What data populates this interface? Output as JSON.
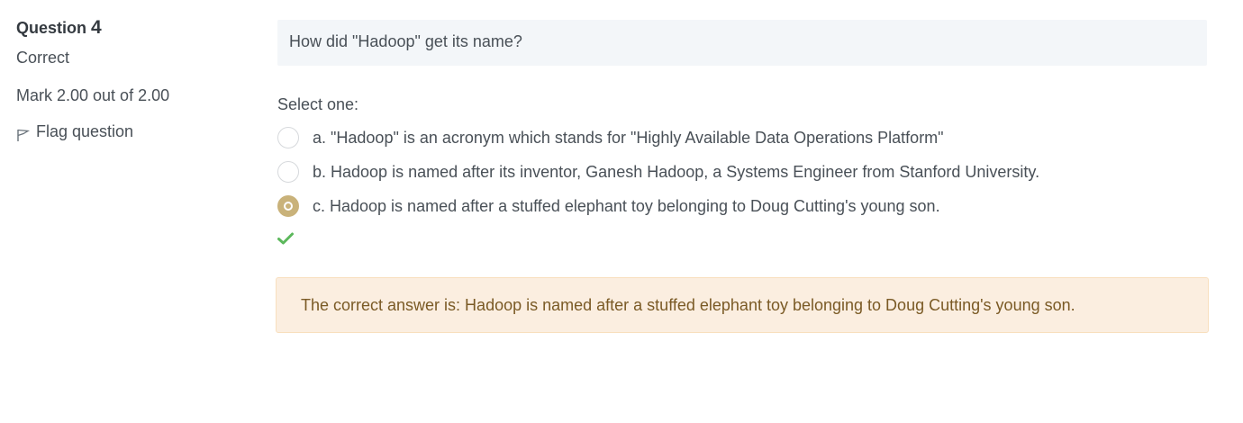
{
  "question": {
    "label": "Question",
    "number": "4",
    "state": "Correct",
    "grade": "Mark 2.00 out of 2.00",
    "flag_label": "Flag question",
    "text": "How did \"Hadoop\" get its name?"
  },
  "prompt": "Select one:",
  "answers": [
    {
      "label": "a. \"Hadoop\" is an acronym which stands for \"Highly Available Data Operations Platform\"",
      "selected": false
    },
    {
      "label": "b. Hadoop is named after its inventor, Ganesh Hadoop, a Systems Engineer from Stanford University.",
      "selected": false
    },
    {
      "label": "c. Hadoop is named after a stuffed elephant toy belonging to Doug Cutting's young son.",
      "selected": true
    }
  ],
  "result_icon": "check-icon",
  "feedback": "The correct answer is: Hadoop is named after a stuffed elephant toy belonging to Doug Cutting's young son.",
  "colors": {
    "selected_radio": "#c9b27a",
    "correct_check": "#5cb85c",
    "feedback_bg": "#fbeee0",
    "feedback_text": "#7a5a25",
    "question_bg": "#f3f6f9"
  }
}
